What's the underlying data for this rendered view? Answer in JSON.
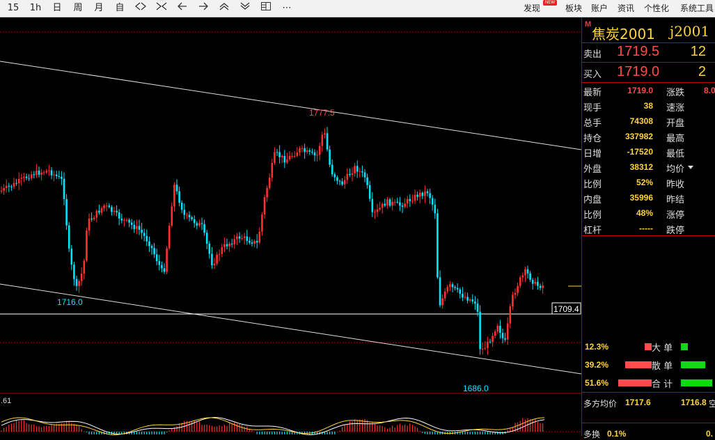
{
  "toolbar": {
    "periods": [
      "15",
      "1h",
      "日",
      "周",
      "月",
      "自"
    ],
    "more": "⋯",
    "right_items": [
      "发现",
      "板块",
      "账户",
      "资讯",
      "个性化",
      "系统工具"
    ],
    "badge": "NEW"
  },
  "quote": {
    "mark": "M",
    "name": "焦炭2001",
    "code": "j2001",
    "sell_label": "卖出",
    "sell_price": "1719.5",
    "sell_vol": "12",
    "buy_label": "买入",
    "buy_price": "1719.0",
    "buy_vol": "2",
    "rows": [
      {
        "k1": "最新",
        "v1": "1719.0",
        "c1": "#ff4b4b",
        "k2": "涨跌",
        "v2": "8.0"
      },
      {
        "k1": "现手",
        "v1": "38",
        "c1": "#ffd43a",
        "k2": "速涨",
        "v2": ""
      },
      {
        "k1": "总手",
        "v1": "74308",
        "c1": "#ffd43a",
        "k2": "开盘",
        "v2": ""
      },
      {
        "k1": "持仓",
        "v1": "337982",
        "c1": "#ffd43a",
        "k2": "最高",
        "v2": ""
      },
      {
        "k1": "日增",
        "v1": "-17520",
        "c1": "#ffd43a",
        "k2": "最低",
        "v2": ""
      },
      {
        "k1": "外盘",
        "v1": "38312",
        "c1": "#ffd43a",
        "k2": "均价",
        "v2": ""
      },
      {
        "k1": "比例",
        "v1": "52%",
        "c1": "#ffd43a",
        "k2": "昨收",
        "v2": ""
      },
      {
        "k1": "内盘",
        "v1": "35996",
        "c1": "#ffd43a",
        "k2": "昨结",
        "v2": ""
      },
      {
        "k1": "比例",
        "v1": "48%",
        "c1": "#ffd43a",
        "k2": "涨停",
        "v2": ""
      },
      {
        "k1": "杠杆",
        "v1": "-----",
        "c1": "#ffd43a",
        "k2": "跌停",
        "v2": ""
      }
    ],
    "flows": [
      {
        "pct": "12.3%",
        "label": "大 单",
        "left_level": 0.15,
        "right_level": 0.1
      },
      {
        "pct": "39.2%",
        "label": "散 单",
        "left_level": 0.6,
        "right_level": 0.35
      },
      {
        "pct": "51.6%",
        "label": "合 计",
        "left_level": 0.75,
        "right_level": 0.45
      }
    ],
    "avg_label": "多方均价",
    "avg_value": "1717.6",
    "avg_right": "1716.8",
    "avg_right_suffix": "空",
    "bottom_label": "多换",
    "bottom_value": "0.1%",
    "bottom_right": "0."
  },
  "chart": {
    "annotations": {
      "high": "1777.5",
      "low_left": "1716.0",
      "low_right": "1686.0"
    },
    "price_tag": "1709.4",
    "indicator_value": ".61"
  },
  "chart_data": {
    "type": "candlestick",
    "annotations": [
      {
        "text": "1777.5",
        "value": 1777.5
      },
      {
        "text": "1716.0",
        "value": 1716.0
      },
      {
        "text": "1686.0",
        "value": 1686.0
      }
    ],
    "current_price": 1709.4
  },
  "colors": {
    "up": "#ff3030",
    "down": "#00e5ff",
    "grid_red": "#b00000",
    "text_yellow": "#ffd43a"
  }
}
